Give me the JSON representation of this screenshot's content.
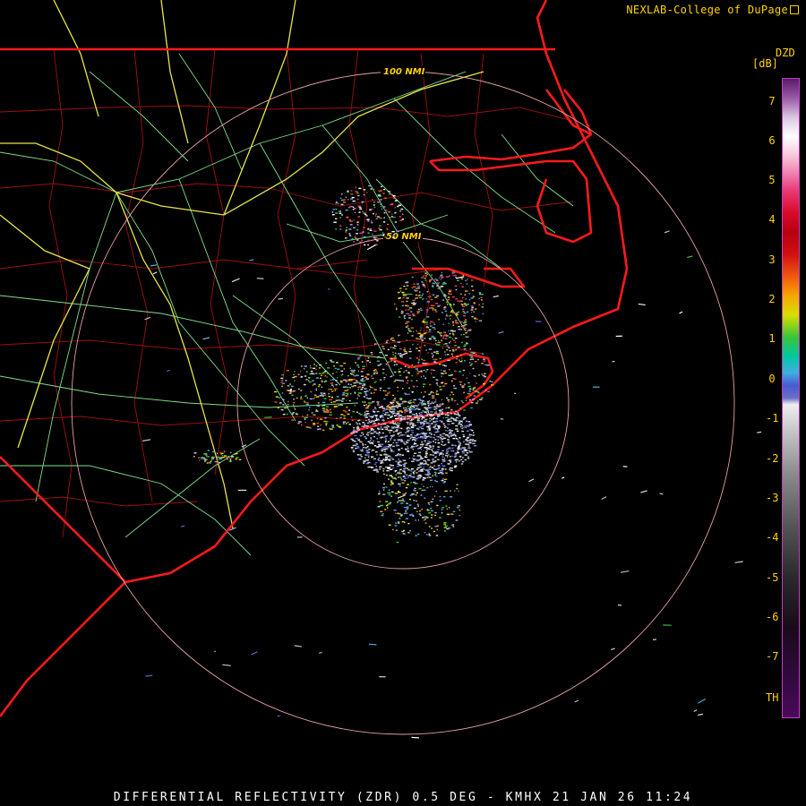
{
  "credit": "NEXLAB-College of DuPage",
  "footer": "DIFFERENTIAL REFLECTIVITY (ZDR) 0.5 DEG - KMHX 21 JAN 26 11:24",
  "legend": {
    "product": "DZD",
    "unit": "[dB]",
    "ticks": [
      "7",
      "6",
      "5",
      "4",
      "3",
      "2",
      "1",
      "0",
      "-1",
      "-2",
      "-3",
      "-4",
      "-5",
      "-6",
      "-7",
      "TH"
    ]
  },
  "range_rings": [
    "100 NMI",
    "50 NMI"
  ],
  "colors": {
    "annotation": "#ffd200",
    "state_border": "#ff1a1a",
    "county_line": "#b01010",
    "highway": "#e6e64a",
    "road": "#7fe08a",
    "range_ring": "#e2a0a0"
  }
}
